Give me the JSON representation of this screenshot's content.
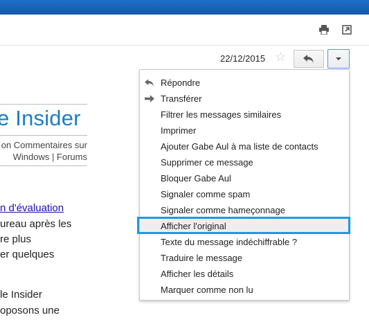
{
  "header": {
    "print_icon": "print-icon",
    "popout_icon": "open-in-new-window-icon",
    "date": "22/12/2015",
    "star_icon": "star-icon",
    "reply_icon": "reply-arrow-icon",
    "more_icon": "dropdown-caret-icon"
  },
  "background_email": {
    "title": "e Insider",
    "subtitle_line1": "on Commentaires sur",
    "subtitle_line2": "Windows | Forums",
    "link": "n d'évaluation",
    "lines": [
      "ureau après les",
      "re plus",
      "er quelques",
      "le Insider",
      "oposons une"
    ]
  },
  "menu": {
    "items": [
      {
        "label": "Répondre",
        "icon": "reply-arrow-icon"
      },
      {
        "label": "Transférer",
        "icon": "forward-arrow-icon"
      },
      {
        "label": "Filtrer les messages similaires"
      },
      {
        "label": "Imprimer"
      },
      {
        "label": "Ajouter Gabe Aul à ma liste de contacts"
      },
      {
        "label": "Supprimer ce message"
      },
      {
        "label": "Bloquer Gabe Aul"
      },
      {
        "label": "Signaler comme spam"
      },
      {
        "label": "Signaler comme hameçonnage"
      },
      {
        "label": "Afficher l'original"
      },
      {
        "label": "Texte du message indéchiffrable ?"
      },
      {
        "label": "Traduire le message"
      },
      {
        "label": "Afficher les détails"
      },
      {
        "label": "Marquer comme non lu"
      }
    ],
    "highlighted": "Afficher l'original"
  },
  "colors": {
    "topbar": "#1d6fc6",
    "title_blue": "#1b7dc4",
    "highlight": "#1a9be0"
  }
}
